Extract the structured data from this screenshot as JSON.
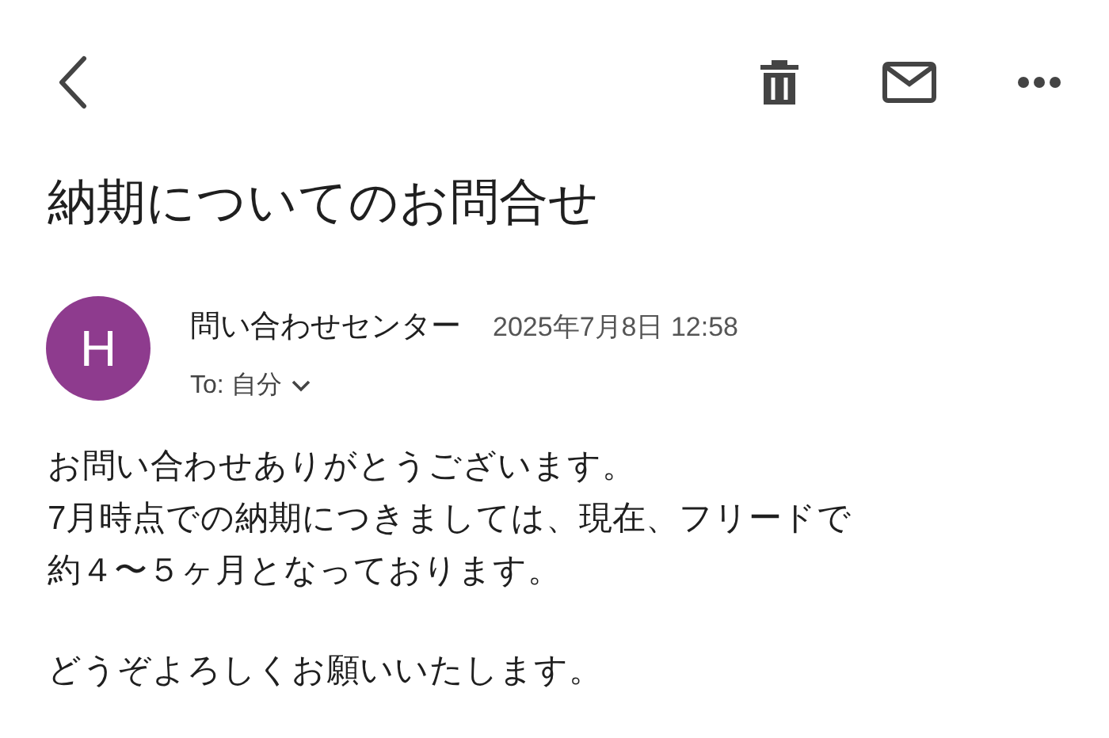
{
  "subject": "納期についてのお問合せ",
  "message": {
    "avatar": "H",
    "sender": "問い合わせセンター",
    "date": "2025年7月8日 12:58",
    "to": "To: 自分"
  },
  "body": [
    [
      "お問い合わせありがとうございます。",
      "7月時点での納期につきましては、現在、フリードで",
      "約４〜５ヶ月となっております。"
    ],
    [
      "どうぞよろしくお願いいたします。"
    ]
  ]
}
